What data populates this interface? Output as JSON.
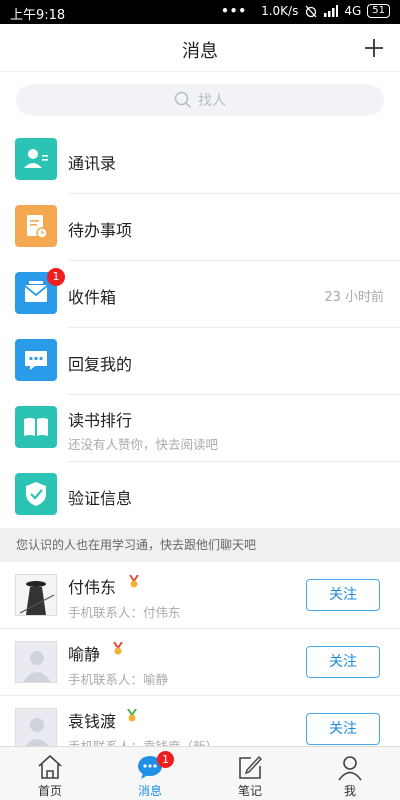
{
  "status_bar": {
    "time": "上午9:18",
    "dots": "•••",
    "network_speed": "1.0K/s",
    "signal": "4G",
    "battery": "51"
  },
  "header": {
    "title": "消息",
    "add_icon": "plus-icon"
  },
  "search": {
    "placeholder": "找人",
    "icon": "search-icon"
  },
  "entries": [
    {
      "label": "通讯录",
      "icon": "contacts-icon",
      "color": "#2bc3b4"
    },
    {
      "label": "待办事项",
      "icon": "todo-icon",
      "color": "#f4a852"
    },
    {
      "label": "收件箱",
      "icon": "mail-icon",
      "color": "#2a9be9",
      "badge": "1",
      "time": "23 小时前"
    },
    {
      "label": "回复我的",
      "icon": "reply-icon",
      "color": "#2a9be9"
    },
    {
      "label": "读书排行",
      "icon": "book-icon",
      "color": "#2bc3b4",
      "subtitle": "还没有人赞你，快去阅读吧"
    },
    {
      "label": "验证信息",
      "icon": "verify-shield-icon",
      "color": "#2bc3b4"
    }
  ],
  "section_header": "您认识的人也在用学习通，快去跟他们聊天吧",
  "people": [
    {
      "name": "付伟东",
      "subtitle": "手机联系人：付伟东",
      "button": "关注",
      "avatar": "photo-avatar"
    },
    {
      "name": "喻静",
      "subtitle": "手机联系人：喻静",
      "button": "关注",
      "avatar": "default-avatar"
    },
    {
      "name": "袁钱渡",
      "subtitle": "手机联系人：袁钱度（新）",
      "button": "关注",
      "avatar": "default-avatar"
    }
  ],
  "tabs": [
    {
      "label": "首页",
      "icon": "home-icon",
      "active": false
    },
    {
      "label": "消息",
      "icon": "message-icon",
      "active": true,
      "badge": "1"
    },
    {
      "label": "笔记",
      "icon": "note-icon",
      "active": false
    },
    {
      "label": "我",
      "icon": "person-icon",
      "active": false
    }
  ],
  "colors": {
    "accent": "#1e90e6",
    "badge": "#f01f1f",
    "teal": "#2bc3b4",
    "orange": "#f4a852",
    "blue": "#2a9be9"
  }
}
